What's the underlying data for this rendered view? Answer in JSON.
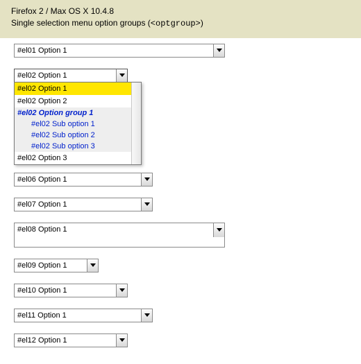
{
  "header": {
    "line1": "Firefox 2 / Max OS X 10.4.8",
    "line2_prefix": "Single selection menu option groups (",
    "line2_code": "<optgroup>",
    "line2_suffix": ")"
  },
  "selects": {
    "el01": "#el01 Option 1",
    "el02": "#el02 Option 1",
    "el06": "#el06 Option 1",
    "el07": "#el07 Option 1",
    "el08": "#el08 Option 1",
    "el09": "#el09 Option 1",
    "el10": "#el10 Option 1",
    "el11": "#el11 Option 1",
    "el12": "#el12 Option 1"
  },
  "el02_menu": {
    "opt1": "#el02 Option 1",
    "opt2": "#el02 Option 2",
    "group1_label": "#el02 Option group 1",
    "sub1": "#el02 Sub option 1",
    "sub2": "#el02 Sub option 2",
    "sub3": "#el02 Sub option 3",
    "opt3": "#el02 Option 3"
  }
}
